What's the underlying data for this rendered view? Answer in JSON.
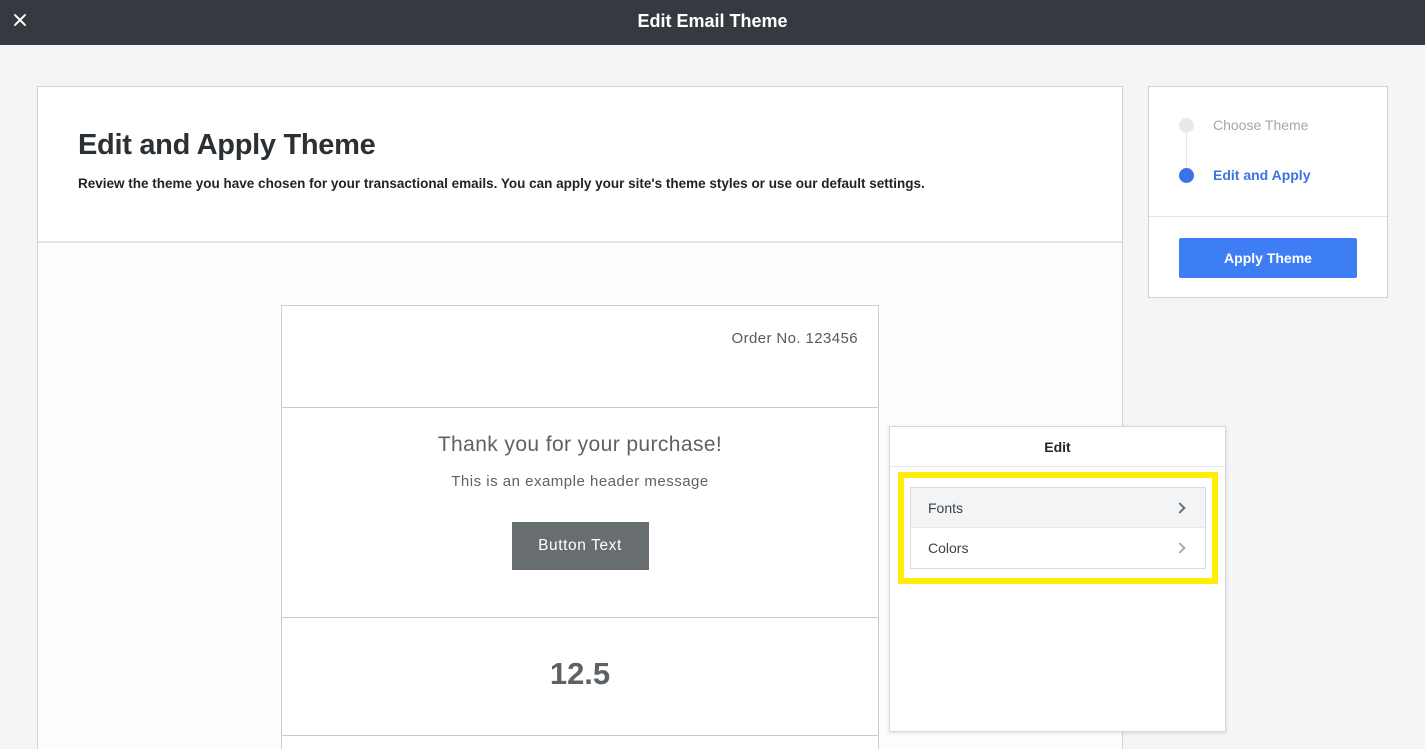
{
  "topbar": {
    "title": "Edit Email Theme",
    "close_icon": "close-icon"
  },
  "main": {
    "heading": "Edit and Apply Theme",
    "description": "Review the theme you have chosen for your transactional emails. You can apply your site's theme styles or use our default settings."
  },
  "email_preview": {
    "order_number": "Order No. 123456",
    "thanks_text": "Thank you for your purchase!",
    "header_message": "This is an example header message",
    "button_text": "Button Text",
    "number_value": "12.5"
  },
  "steps": {
    "items": [
      {
        "label": "Choose Theme",
        "state": "complete"
      },
      {
        "label": "Edit and Apply",
        "state": "active"
      }
    ],
    "apply_button": "Apply Theme"
  },
  "edit_panel": {
    "title": "Edit",
    "items": [
      {
        "label": "Fonts",
        "icon": "chevron-right-icon"
      },
      {
        "label": "Colors",
        "icon": "chevron-right-icon"
      }
    ]
  },
  "colors": {
    "topbar": "#353a40",
    "accent": "#3d7ef5",
    "highlight": "#ffee00"
  }
}
